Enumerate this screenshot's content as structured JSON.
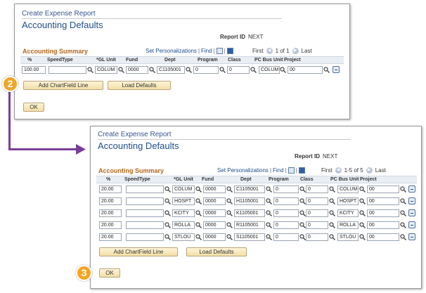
{
  "panel1": {
    "breadcrumb": "Create Expense Report",
    "title": "Accounting Defaults",
    "report_id_label": "Report ID",
    "report_id_value": "NEXT",
    "grid_label": "Accounting Summary",
    "personalize": "Set Personalizations",
    "find": "Find",
    "first": "First",
    "range": "1 of 1",
    "last": "Last",
    "columns": {
      "pct": "%",
      "speed": "SpeedType",
      "gl": "*GL Unit",
      "fund": "Fund",
      "dept": "Dept",
      "program": "Program",
      "class": "Class",
      "pcbu": "PC Bus Unit",
      "project": "Project"
    },
    "rows": [
      {
        "pct": "100.00",
        "speed": "",
        "gl": "COLUM",
        "fund": "0000",
        "dept": "C1105001",
        "program": "0",
        "class": "0",
        "pcbu": "COLUM",
        "project": "00"
      }
    ],
    "add_line": "Add ChartField Line",
    "load_defaults": "Load Defaults",
    "ok": "OK"
  },
  "panel2": {
    "breadcrumb": "Create Expense Report",
    "title": "Accounting Defaults",
    "report_id_label": "Report ID",
    "report_id_value": "NEXT",
    "grid_label": "Accounting Summary",
    "personalize": "Set Personalizations",
    "find": "Find",
    "first": "First",
    "range": "1-5 of 5",
    "last": "Last",
    "columns": {
      "pct": "%",
      "speed": "SpeedType",
      "gl": "*GL Unit",
      "fund": "Fund",
      "dept": "Dept",
      "program": "Program",
      "class": "Class",
      "pcbu": "PC Bus Unit",
      "project": "Project"
    },
    "rows": [
      {
        "pct": "20.00",
        "speed": "",
        "gl": "COLUM",
        "fund": "0000",
        "dept": "C1105001",
        "program": "0",
        "class": "0",
        "pcbu": "COLUM",
        "project": "00"
      },
      {
        "pct": "20.00",
        "speed": "",
        "gl": "HOSPT",
        "fund": "0000",
        "dept": "H1105001",
        "program": "0",
        "class": "0",
        "pcbu": "HOSPT",
        "project": "00"
      },
      {
        "pct": "20.00",
        "speed": "",
        "gl": "KCITY",
        "fund": "0000",
        "dept": "K1105001",
        "program": "0",
        "class": "0",
        "pcbu": "KCITY",
        "project": "00"
      },
      {
        "pct": "20.00",
        "speed": "",
        "gl": "ROLLA",
        "fund": "0000",
        "dept": "R1105001",
        "program": "0",
        "class": "0",
        "pcbu": "ROLLA",
        "project": "00"
      },
      {
        "pct": "20.00",
        "speed": "",
        "gl": "STLOU",
        "fund": "0000",
        "dept": "S1105001",
        "program": "0",
        "class": "0",
        "pcbu": "STLOU",
        "project": "00"
      }
    ],
    "add_line": "Add ChartField Line",
    "load_defaults": "Load Defaults",
    "ok": "OK"
  },
  "callouts": {
    "step2": "2",
    "step3": "3"
  },
  "colors": {
    "callout": "#f3a526",
    "arrow": "#7b3f98",
    "title": "#1e4e8a",
    "grid_label": "#b4661a"
  }
}
